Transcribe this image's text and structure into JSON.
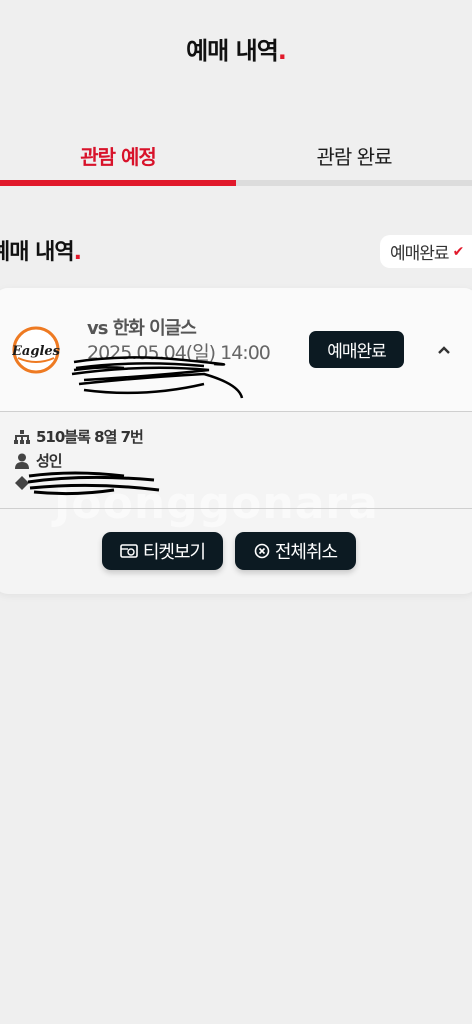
{
  "header": {
    "title": "예매 내역",
    "title_dot": "."
  },
  "tabs": [
    {
      "label": "관람 예정",
      "active": true
    },
    {
      "label": "관람 완료",
      "active": false
    }
  ],
  "section": {
    "title": "예매 내역",
    "title_dot": "."
  },
  "filter": {
    "label": "예매완료"
  },
  "booking": {
    "team": "vs 한화 이글스",
    "logo_text": "Eagles",
    "date": "2025.05.04(일) 14:00",
    "status": "예매완료",
    "seat": "510블록 8열 7번",
    "ticket_type": "성인",
    "watermark": "Joonggonara",
    "buttons": {
      "ticket": "티켓보기",
      "cancel": "전체취소"
    }
  },
  "colors": {
    "accent": "#e1192b",
    "dark_button": "#0c1a22"
  }
}
